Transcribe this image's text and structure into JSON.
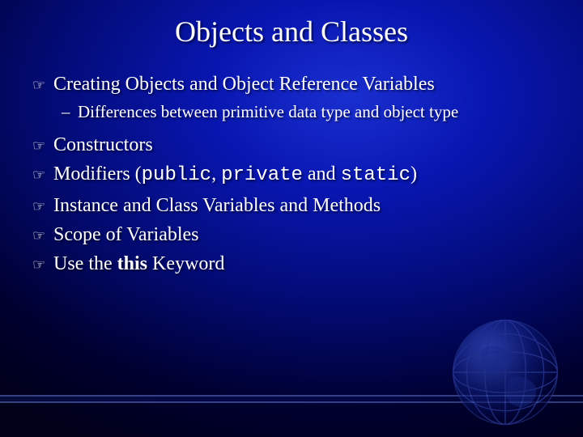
{
  "title": "Objects and Classes",
  "bullets": {
    "b1": "Creating Objects and Object Reference Variables",
    "b1_sub": "Differences between primitive data type and object type",
    "b2": "Constructors",
    "b3_pre": "Modifiers (",
    "b3_code1": "public",
    "b3_sep1": ", ",
    "b3_code2": "private",
    "b3_sep2": " and ",
    "b3_code3": "static",
    "b3_post": ")",
    "b4": "Instance and Class Variables and Methods",
    "b5": "Scope of Variables",
    "b6_pre": "Use the ",
    "b6_bold": "this",
    "b6_post": " Keyword"
  },
  "glyphs": {
    "pointer": "☞",
    "dash": "–"
  }
}
